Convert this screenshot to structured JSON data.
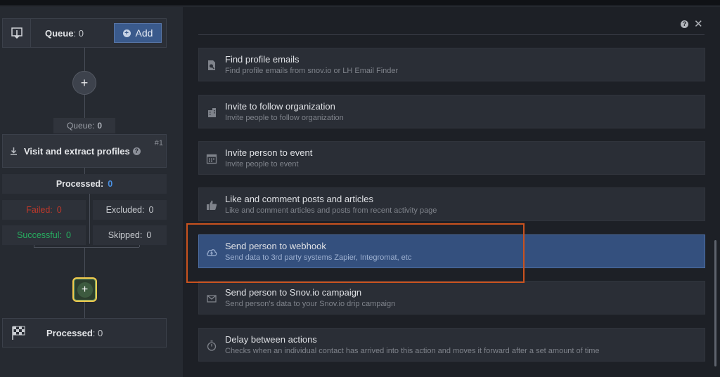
{
  "workflow": {
    "queue_card": {
      "label": "Queue",
      "sep": ":",
      "count": "0",
      "add_label": "Add"
    },
    "queue_tag": {
      "label": "Queue:",
      "count": "0"
    },
    "visit_card": {
      "title": "Visit and extract profiles",
      "number": "#1"
    },
    "stats": {
      "processed": {
        "label": "Processed:",
        "value": "0"
      },
      "failed": {
        "label": "Failed:",
        "value": "0"
      },
      "excluded": {
        "label": "Excluded:",
        "value": "0"
      },
      "successful": {
        "label": "Successful:",
        "value": "0"
      },
      "skipped": {
        "label": "Skipped:",
        "value": "0"
      }
    },
    "end_card": {
      "label": "Processed",
      "sep": ":",
      "count": "0"
    },
    "plus_symbol": "+"
  },
  "actions": [
    {
      "title": "Find profile emails",
      "desc": "Find profile emails from snov.io or LH Email Finder",
      "icon": "email-search-icon"
    },
    {
      "title": "Invite to follow organization",
      "desc": "Invite people to follow organization",
      "icon": "building-icon"
    },
    {
      "title": "Invite person to event",
      "desc": "Invite people to event",
      "icon": "calendar-icon"
    },
    {
      "title": "Like and comment posts and articles",
      "desc": "Like and comment articles and posts from recent activity page",
      "icon": "thumbs-up-icon"
    },
    {
      "title": "Send person to webhook",
      "desc": "Send data to 3rd party systems Zapier, Integromat, etc",
      "icon": "cloud-upload-icon",
      "selected": true
    },
    {
      "title": "Send person to Snov.io campaign",
      "desc": "Send person's data to your Snov.io drip campaign",
      "icon": "envelope-icon"
    },
    {
      "title": "Delay between actions",
      "desc": "Checks when an individual contact has arrived into this action and moves it forward after a set amount of time",
      "icon": "stopwatch-icon"
    }
  ],
  "colors": {
    "accent": "#3a5a8c",
    "selected_bg": "#34507e",
    "failed": "#c0392b",
    "successful": "#27ae60",
    "processed_value": "#4a90e2",
    "highlight": "#c9521e",
    "active_ring": "#f2c94c"
  }
}
